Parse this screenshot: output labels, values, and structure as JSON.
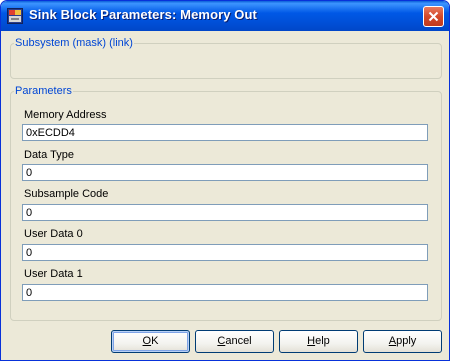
{
  "window": {
    "title": "Sink Block Parameters: Memory Out"
  },
  "mask_group": {
    "legend": "Subsystem (mask) (link)"
  },
  "parameters": {
    "legend": "Parameters",
    "fields": [
      {
        "label": "Memory Address",
        "value": "0xECDD4"
      },
      {
        "label": "Data Type",
        "value": "0"
      },
      {
        "label": "Subsample Code",
        "value": "0"
      },
      {
        "label": "User Data 0",
        "value": "0"
      },
      {
        "label": "User Data 1",
        "value": "0"
      }
    ]
  },
  "buttons": {
    "ok": {
      "mnemonic": "O",
      "rest": "K"
    },
    "cancel": {
      "mnemonic": "C",
      "rest": "ancel"
    },
    "help": {
      "mnemonic": "H",
      "rest": "elp"
    },
    "apply": {
      "mnemonic": "A",
      "rest": "pply"
    }
  },
  "icons": {
    "app": "simulink-block-icon",
    "close": "close-icon"
  },
  "colors": {
    "titlebar": "#0058e6",
    "dialog_bg": "#ece9d8",
    "legend_text": "#0046d5",
    "close_button": "#d4492a"
  }
}
